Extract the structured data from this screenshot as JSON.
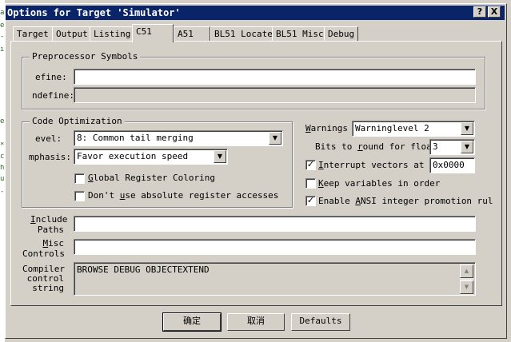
{
  "window": {
    "title": "Options for Target 'Simulator'",
    "help_button": "?",
    "close_button": "X"
  },
  "tabs": [
    {
      "label": "Target"
    },
    {
      "label": "Output"
    },
    {
      "label": "Listing"
    },
    {
      "label": "C51",
      "active": true
    },
    {
      "label": "A51"
    },
    {
      "label": "BL51 Locate"
    },
    {
      "label": "BL51 Misc"
    },
    {
      "label": "Debug"
    }
  ],
  "preprocessor": {
    "legend": "Preprocessor Symbols",
    "define_label": "efine:",
    "define_value": "",
    "undefine_label": "ndefine:",
    "undefine_value": ""
  },
  "code_optimization": {
    "legend": "Code Optimization",
    "level_label": "evel:",
    "level_value": "8: Common tail merging",
    "emphasis_label": "mphasis:",
    "emphasis_value": "Favor execution speed",
    "global_register_label": "lobal Register Coloring",
    "global_register_key": "G",
    "global_register_checked": false,
    "no_abs_label_pre": "Don't ",
    "no_abs_key": "u",
    "no_abs_label_post": "se absolute register accesses",
    "no_abs_checked": false
  },
  "right_options": {
    "warnings_key": "W",
    "warnings_label": "arnings",
    "warnings_value": "Warninglevel 2",
    "bits_label_pre": "Bits to ",
    "bits_key": "r",
    "bits_label_post": "ound for float",
    "bits_value": "3",
    "interrupt_key": "I",
    "interrupt_label": "nterrupt vectors at a",
    "interrupt_value": "0x0000",
    "interrupt_checked": true,
    "keep_key": "K",
    "keep_label": "eep variables in order",
    "keep_checked": false,
    "ansi_pre": "Enable ",
    "ansi_key": "A",
    "ansi_post": "NSI integer promotion rul",
    "ansi_checked": true
  },
  "include": {
    "label_line1_key": "I",
    "label_line1": "nclude",
    "label_line2": "Paths",
    "value": ""
  },
  "misc": {
    "label_line1_key": "M",
    "label_line1": "isc",
    "label_line2": "Controls",
    "value": ""
  },
  "compiler": {
    "label_line1": "Compiler",
    "label_line2": "control",
    "label_line3": "string",
    "value": "BROWSE DEBUG OBJECTEXTEND"
  },
  "buttons": {
    "ok": "确定",
    "cancel": "取消",
    "defaults": "Defaults"
  },
  "left_edge_glyphs": [
    "a",
    "e",
    "-",
    "i",
    "e",
    "*",
    "c",
    "h",
    "u",
    "-"
  ],
  "check_mark": "✓",
  "combo_arrow": "▼",
  "scroll_up": "▲",
  "scroll_down": "▼"
}
